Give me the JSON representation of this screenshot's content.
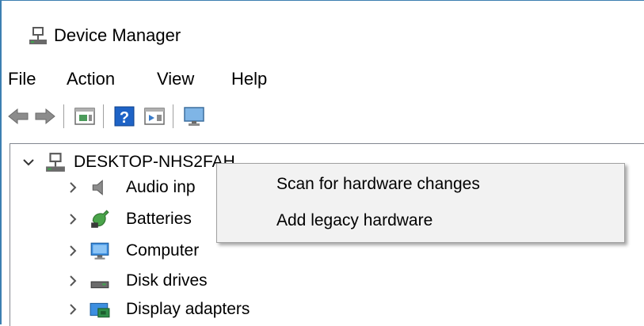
{
  "window": {
    "title": "Device Manager"
  },
  "menubar": {
    "items": [
      "File",
      "Action",
      "View",
      "Help"
    ]
  },
  "toolbar": {
    "buttons": [
      "back-icon",
      "forward-icon",
      "properties-icon",
      "help-icon",
      "update-driver-icon",
      "monitor-icon"
    ]
  },
  "tree": {
    "root": {
      "label": "DESKTOP-NHS2FAH",
      "expanded": true,
      "icon": "computer-network-icon"
    },
    "children": [
      {
        "label": "Audio inp",
        "icon": "speaker-icon"
      },
      {
        "label": "Batteries",
        "icon": "battery-icon"
      },
      {
        "label": "Computer",
        "icon": "monitor-icon"
      },
      {
        "label": "Disk drives",
        "icon": "disk-drive-icon"
      },
      {
        "label": "Display adapters",
        "icon": "display-adapter-icon"
      }
    ]
  },
  "context_menu": {
    "items": [
      "Scan for hardware changes",
      "Add legacy hardware"
    ]
  }
}
